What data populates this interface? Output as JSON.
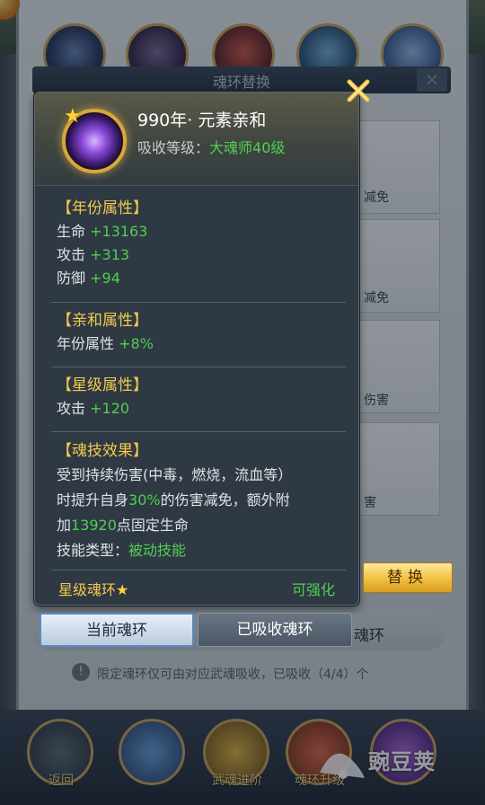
{
  "background": {
    "panel_title": "魂环替换",
    "right_cards": [
      {
        "label": "减免"
      },
      {
        "label": "减免"
      },
      {
        "label": "伤害"
      },
      {
        "label": "害"
      }
    ],
    "tab_right_text": "魂环",
    "hint_text": "限定魂环仅可由对应武魂吸收，已吸收（4/4）个",
    "nav_labels": [
      "返回",
      "",
      "武魂进阶",
      "魂环升级",
      ""
    ],
    "watermark": "豌豆荚"
  },
  "popup": {
    "item_name": "990年·  元素亲和",
    "absorb_label": "吸收等级：",
    "absorb_value": "大魂师40级",
    "year_section": {
      "title": "【年份属性】",
      "stats": [
        {
          "label": "生命",
          "value": "+13163"
        },
        {
          "label": "攻击",
          "value": "+313"
        },
        {
          "label": "防御",
          "value": "+94"
        }
      ]
    },
    "affinity_section": {
      "title": "【亲和属性】",
      "stats": [
        {
          "label": "年份属性",
          "value": "+8%"
        }
      ]
    },
    "star_section": {
      "title": "【星级属性】",
      "stats": [
        {
          "label": "攻击",
          "value": "+120"
        }
      ]
    },
    "skill_section": {
      "title": "【魂技效果】",
      "line1": "受到持续伤害(中毒，燃烧，流血等）",
      "line2_pre": "时提升自身",
      "line2_value": "30%",
      "line2_post": "的伤害减免，额外附",
      "line3_pre": "加",
      "line3_value": "13920",
      "line3_post": "点固定生命",
      "line4_label": "技能类型：",
      "line4_value": "被动技能"
    },
    "footer_left": "星级魂环",
    "footer_star": "★",
    "footer_right": "可强化"
  },
  "buttons": {
    "replace": "替换",
    "tab_current": "当前魂环",
    "tab_absorbed": "已吸收魂环"
  },
  "colors": {
    "accent_gold": "#f2c94c",
    "stat_green": "#4fd04f",
    "popup_bg": "#2f3944"
  }
}
